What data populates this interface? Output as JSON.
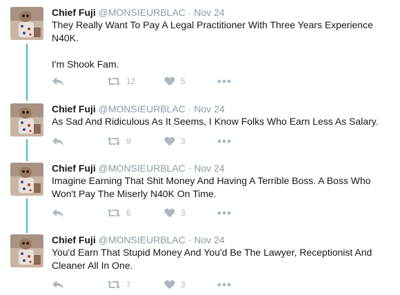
{
  "author": {
    "name": "Chief Fuji",
    "handle": "@MONSIEURBLAC",
    "separator": "·",
    "avatar_icon": "meerkat-avatar"
  },
  "colors": {
    "thread_line": "#4ab3c7",
    "action_icon": "#aab8c2",
    "muted_text": "#8899a6"
  },
  "tweets": [
    {
      "date": "Nov 24",
      "text": "They Really Want To Pay A Legal Practitioner With Three Years Experience N40K.\n\nI'm Shook Fam.",
      "retweets": "12",
      "likes": "5"
    },
    {
      "date": "Nov 24",
      "text": "As Sad And Ridiculous As It Seems, I Know Folks Who Earn Less As Salary.",
      "retweets": "9",
      "likes": "3"
    },
    {
      "date": "Nov 24",
      "text": "Imagine Earning That Shit Money And Having A Terrible Boss. A Boss Who Won't Pay The Miserly N40K On Time.",
      "retweets": "6",
      "likes": "3"
    },
    {
      "date": "Nov 24",
      "text": "You'd Earn That Stupid Money And You'd Be The Lawyer, Receptionist And Cleaner All In One.",
      "retweets": "7",
      "likes": "3"
    }
  ]
}
